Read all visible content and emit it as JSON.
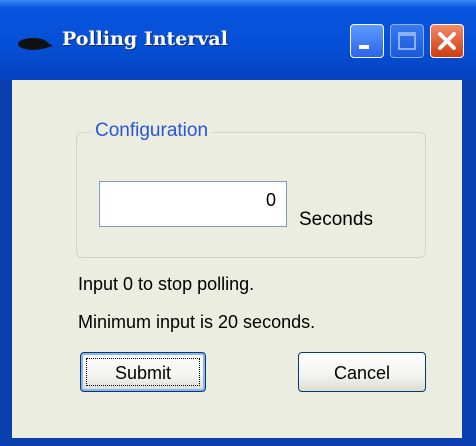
{
  "window": {
    "title": "Polling Interval",
    "controls": [
      "minimize-icon",
      "maximize-icon",
      "close-icon"
    ]
  },
  "configuration": {
    "legend": "Configuration",
    "interval_value": "0",
    "unit_label": "Seconds"
  },
  "hints": {
    "line1": "Input 0 to stop polling.",
    "line2": "Minimum input is 20 seconds."
  },
  "buttons": {
    "submit": "Submit",
    "cancel": "Cancel"
  },
  "colors": {
    "titlebar": "#0650d6",
    "client_background": "#ebede0",
    "legend_text": "#2a55d8",
    "close_button": "#d03a10"
  }
}
